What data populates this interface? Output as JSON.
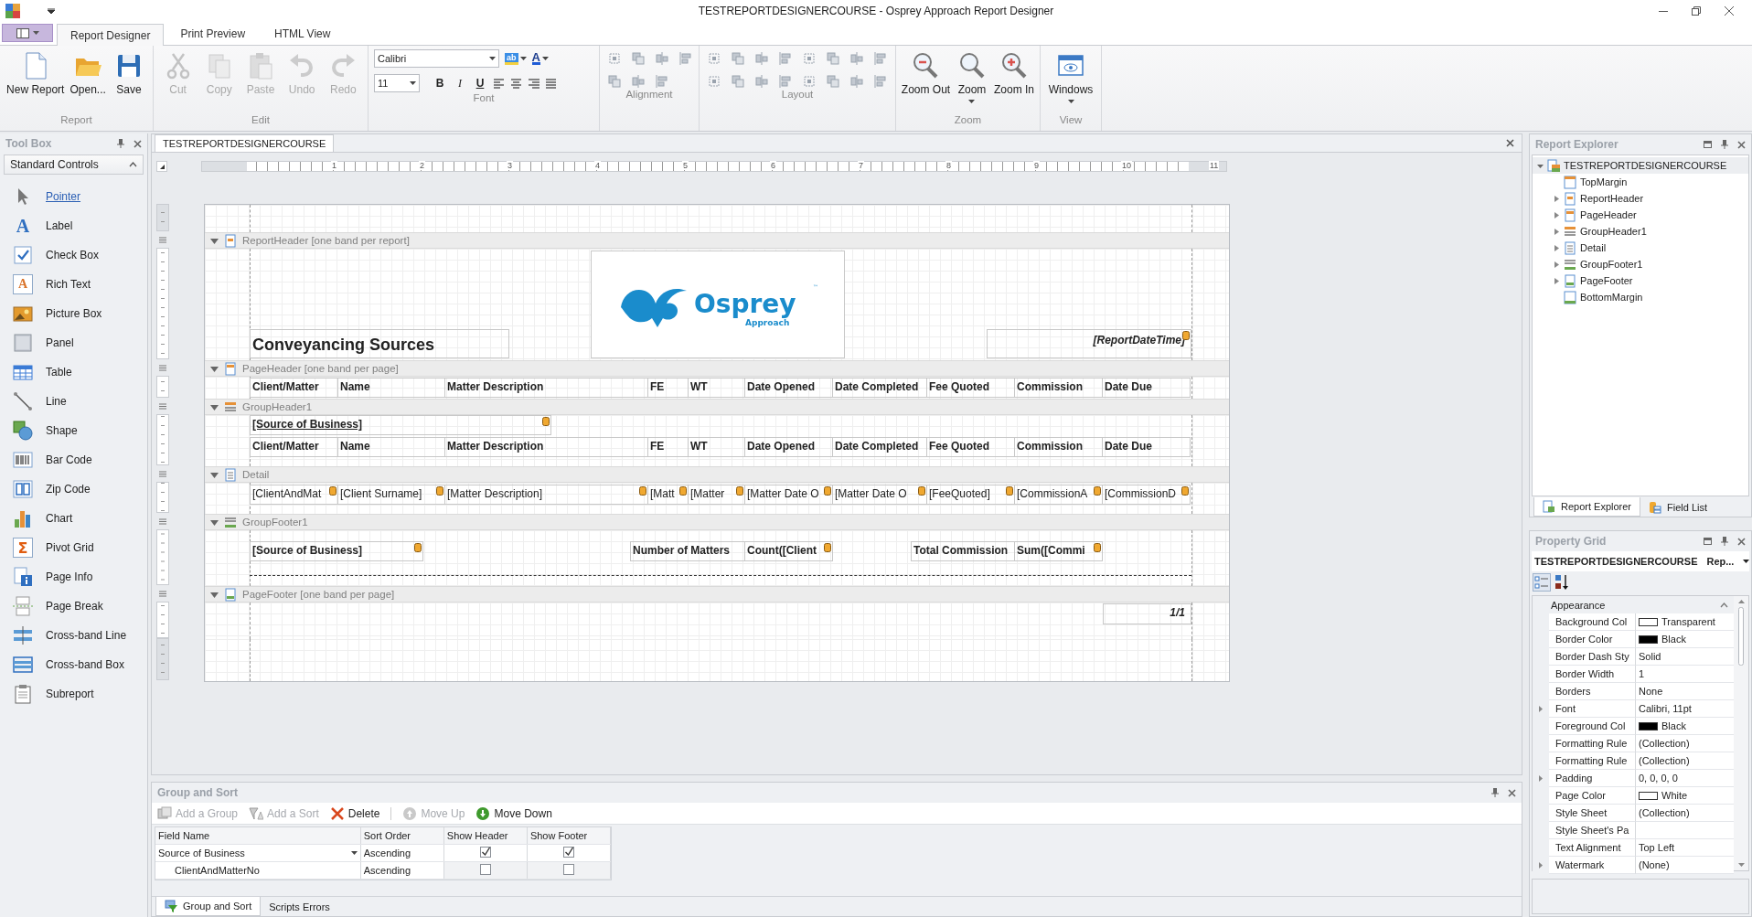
{
  "window": {
    "title": "TESTREPORTDESIGNERCOURSE - Osprey Approach Report Designer"
  },
  "ribbon": {
    "tabs": [
      {
        "label": "Report Designer",
        "selected": true
      },
      {
        "label": "Print Preview",
        "selected": false
      },
      {
        "label": "HTML View",
        "selected": false
      }
    ],
    "groups": [
      {
        "kind": "large",
        "label": "Report",
        "buttons": [
          {
            "label": "New Report",
            "disabled": false,
            "dropdown": false
          },
          {
            "label": "Open...",
            "disabled": false,
            "dropdown": false
          },
          {
            "label": "Save",
            "disabled": false,
            "dropdown": false
          }
        ]
      },
      {
        "kind": "large",
        "label": "Edit",
        "buttons": [
          {
            "label": "Cut",
            "disabled": true,
            "dropdown": false
          },
          {
            "label": "Copy",
            "disabled": true,
            "dropdown": false
          },
          {
            "label": "Paste",
            "disabled": true,
            "dropdown": false
          },
          {
            "label": "Undo",
            "disabled": true,
            "dropdown": false
          },
          {
            "label": "Redo",
            "disabled": true,
            "dropdown": false
          }
        ]
      },
      {
        "kind": "font",
        "label": "Font",
        "font_name": "Calibri",
        "font_size": "11",
        "highlight_glyph": "ab",
        "font_color_glyph": "A",
        "styles": [
          "B",
          "I",
          "U"
        ]
      },
      {
        "kind": "icons",
        "label": "Alignment"
      },
      {
        "kind": "icons",
        "label": "Layout"
      },
      {
        "kind": "large",
        "label": "Zoom",
        "buttons": [
          {
            "label": "Zoom Out",
            "disabled": false,
            "dropdown": false
          },
          {
            "label": "Zoom",
            "disabled": false,
            "dropdown": true
          },
          {
            "label": "Zoom In",
            "disabled": false,
            "dropdown": false
          }
        ]
      },
      {
        "kind": "large",
        "label": "View",
        "buttons": [
          {
            "label": "Windows",
            "disabled": false,
            "dropdown": true
          }
        ]
      }
    ]
  },
  "toolbox": {
    "title": "Tool Box",
    "category": "Standard Controls",
    "items": [
      {
        "label": "Pointer",
        "selected": true
      },
      {
        "label": "Label",
        "selected": false,
        "glyph": "A"
      },
      {
        "label": "Check Box",
        "selected": false
      },
      {
        "label": "Rich Text",
        "selected": false,
        "glyph": "A"
      },
      {
        "label": "Picture Box",
        "selected": false
      },
      {
        "label": "Panel",
        "selected": false
      },
      {
        "label": "Table",
        "selected": false
      },
      {
        "label": "Line",
        "selected": false
      },
      {
        "label": "Shape",
        "selected": false
      },
      {
        "label": "Bar Code",
        "selected": false
      },
      {
        "label": "Zip Code",
        "selected": false
      },
      {
        "label": "Chart",
        "selected": false
      },
      {
        "label": "Pivot Grid",
        "selected": false,
        "glyph": "Σ"
      },
      {
        "label": "Page Info",
        "selected": false
      },
      {
        "label": "Page Break",
        "selected": false
      },
      {
        "label": "Cross-band Line",
        "selected": false
      },
      {
        "label": "Cross-band Box",
        "selected": false
      },
      {
        "label": "Subreport",
        "selected": false
      }
    ]
  },
  "document_tab": "TESTREPORTDESIGNERCOURSE",
  "ruler_labels": [
    "1",
    "2",
    "3",
    "4",
    "5",
    "6",
    "7",
    "8",
    "9",
    "10",
    "11"
  ],
  "report": {
    "bands": [
      {
        "kind": "top_margin"
      },
      {
        "kind": "report_header",
        "label": "ReportHeader [one band per report]",
        "expanded": true,
        "title": "Conveyancing Sources",
        "logo": {
          "name": "Osprey",
          "tagline": "Approach",
          "mark": "™"
        },
        "date_field": {
          "text": "[ReportDateTime]",
          "smart_tag": true
        }
      },
      {
        "kind": "page_header",
        "label": "PageHeader [one band per page]",
        "expanded": true,
        "rows": [
          [
            {
              "text": "Client/Matter",
              "smart_tag": false
            },
            {
              "text": "Name",
              "smart_tag": false
            },
            {
              "text": "Matter Description",
              "smart_tag": false
            },
            {
              "text": "FE",
              "smart_tag": false
            },
            {
              "text": "WT",
              "smart_tag": false
            },
            {
              "text": "Date Opened",
              "smart_tag": false
            },
            {
              "text": "Date Completed",
              "smart_tag": false
            },
            {
              "text": "Fee Quoted",
              "smart_tag": false
            },
            {
              "text": "Commission",
              "smart_tag": false
            },
            {
              "text": "Date Due",
              "smart_tag": false
            }
          ]
        ]
      },
      {
        "kind": "group_header",
        "label": "GroupHeader1",
        "expanded": true,
        "group_field": {
          "text": "[Source of Business]",
          "smart_tag": true
        },
        "rows": [
          [
            {
              "text": "Client/Matter",
              "smart_tag": false
            },
            {
              "text": "Name",
              "smart_tag": false
            },
            {
              "text": "Matter Description",
              "smart_tag": false
            },
            {
              "text": "FE",
              "smart_tag": false
            },
            {
              "text": "WT",
              "smart_tag": false
            },
            {
              "text": "Date Opened",
              "smart_tag": false
            },
            {
              "text": "Date Completed",
              "smart_tag": false
            },
            {
              "text": "Fee Quoted",
              "smart_tag": false
            },
            {
              "text": "Commission",
              "smart_tag": false
            },
            {
              "text": "Date Due",
              "smart_tag": false
            }
          ]
        ]
      },
      {
        "kind": "detail",
        "label": "Detail",
        "expanded": true,
        "rows": [
          [
            {
              "text": "[ClientAndMat",
              "smart_tag": true
            },
            {
              "text": "[Client Surname]",
              "smart_tag": true
            },
            {
              "text": "[Matter Description]",
              "smart_tag": true
            },
            {
              "text": "[Matt",
              "smart_tag": true
            },
            {
              "text": "[Matter",
              "smart_tag": true
            },
            {
              "text": "[Matter Date O",
              "smart_tag": true
            },
            {
              "text": "[Matter Date O",
              "smart_tag": true
            },
            {
              "text": "[FeeQuoted]",
              "smart_tag": true
            },
            {
              "text": "[CommissionA",
              "smart_tag": true
            },
            {
              "text": "[CommissionD",
              "smart_tag": true
            }
          ]
        ]
      },
      {
        "kind": "group_footer",
        "label": "GroupFooter1",
        "expanded": true,
        "fields": [
          {
            "text": "[Source of Business]",
            "smart_tag": true
          },
          {
            "text": "Number of Matters",
            "smart_tag": false
          },
          {
            "text": "Count([Client",
            "smart_tag": true
          },
          {
            "text": "Total Commission",
            "smart_tag": false
          },
          {
            "text": "Sum([Commi",
            "smart_tag": true
          }
        ]
      },
      {
        "kind": "page_footer",
        "label": "PageFooter [one band per page]",
        "expanded": true,
        "page_info": "1/1"
      },
      {
        "kind": "bottom_margin"
      }
    ]
  },
  "group_and_sort": {
    "title": "Group and Sort",
    "toolbar": [
      {
        "label": "Add a Group",
        "disabled": true
      },
      {
        "label": "Add a Sort",
        "disabled": true
      },
      {
        "label": "Delete",
        "disabled": false
      },
      {
        "label": "Move Up",
        "disabled": true
      },
      {
        "label": "Move Down",
        "disabled": false
      }
    ],
    "columns": [
      "Field Name",
      "Sort Order",
      "Show Header",
      "Show Footer"
    ],
    "rows": [
      {
        "field": "Source of Business",
        "sort_order": "Ascending",
        "show_header": true,
        "show_footer": true,
        "selected": true,
        "children": [
          {
            "field": "ClientAndMatterNo",
            "sort_order": "Ascending",
            "show_header": false,
            "show_footer": false,
            "selected": false
          }
        ]
      }
    ],
    "tabs": [
      {
        "label": "Group and Sort",
        "selected": true
      },
      {
        "label": "Scripts Errors",
        "selected": false
      }
    ]
  },
  "report_explorer": {
    "title": "Report Explorer",
    "tree": {
      "label": "TESTREPORTDESIGNERCOURSE",
      "expanded": true,
      "selected": true,
      "children": [
        {
          "label": "TopMargin",
          "expandable": false,
          "selected": false
        },
        {
          "label": "ReportHeader",
          "expandable": true,
          "selected": false
        },
        {
          "label": "PageHeader",
          "expandable": true,
          "selected": false
        },
        {
          "label": "GroupHeader1",
          "expandable": true,
          "selected": false
        },
        {
          "label": "Detail",
          "expandable": true,
          "selected": false
        },
        {
          "label": "GroupFooter1",
          "expandable": true,
          "selected": false
        },
        {
          "label": "PageFooter",
          "expandable": true,
          "selected": false
        },
        {
          "label": "BottomMargin",
          "expandable": false,
          "selected": false
        }
      ]
    },
    "tabs": [
      {
        "label": "Report Explorer",
        "selected": true
      },
      {
        "label": "Field List",
        "selected": false
      }
    ]
  },
  "property_grid": {
    "title": "Property Grid",
    "object_name": "TESTREPORTDESIGNERCOURSE",
    "object_type": "Rep...",
    "category": "Appearance",
    "rows": [
      {
        "name": "Background Col",
        "value": "Transparent",
        "color": "#ffffff",
        "expandable": false
      },
      {
        "name": "Border Color",
        "value": "Black",
        "color": "#000000",
        "expandable": false
      },
      {
        "name": "Border Dash Sty",
        "value": "Solid",
        "expandable": false
      },
      {
        "name": "Border Width",
        "value": "1",
        "expandable": false
      },
      {
        "name": "Borders",
        "value": "None",
        "expandable": false
      },
      {
        "name": "Font",
        "value": "Calibri, 11pt",
        "expandable": true
      },
      {
        "name": "Foreground Col",
        "value": "Black",
        "color": "#000000",
        "expandable": false
      },
      {
        "name": "Formatting Rule",
        "value": "(Collection)",
        "expandable": false
      },
      {
        "name": "Formatting Rule",
        "value": "(Collection)",
        "expandable": false
      },
      {
        "name": "Padding",
        "value": "0, 0, 0, 0",
        "expandable": true
      },
      {
        "name": "Page Color",
        "value": "White",
        "color": "#ffffff",
        "expandable": false
      },
      {
        "name": "Style Sheet",
        "value": "(Collection)",
        "expandable": false
      },
      {
        "name": "Style Sheet's Pa",
        "expandable": false
      },
      {
        "name": "Text Alignment",
        "value": "Top Left",
        "expandable": false
      },
      {
        "name": "Watermark",
        "value": "(None)",
        "expandable": true
      }
    ]
  }
}
